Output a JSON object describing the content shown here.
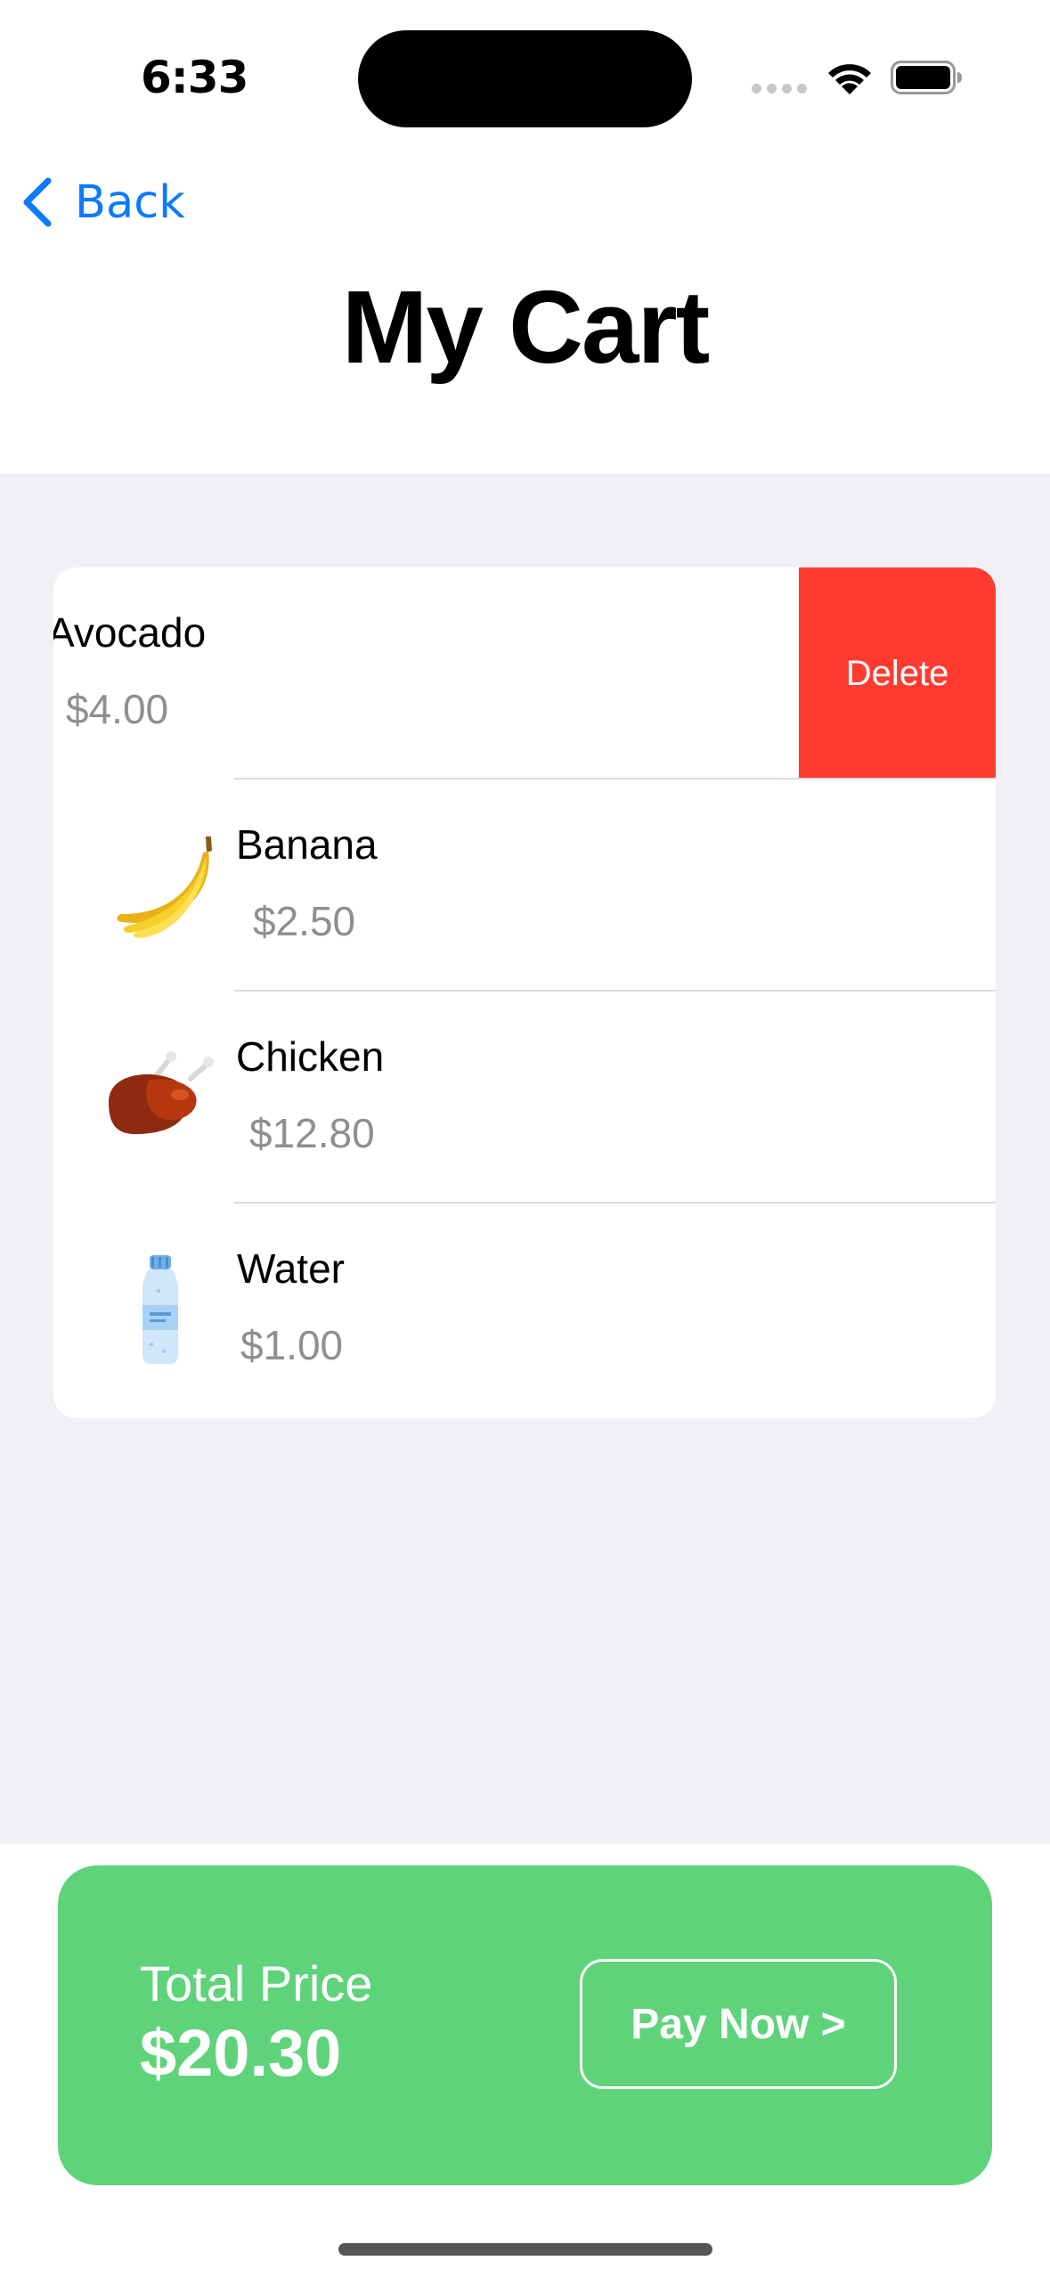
{
  "status_bar": {
    "time": "6:33"
  },
  "nav": {
    "back_label": "Back",
    "title": "My Cart"
  },
  "cart": {
    "items": [
      {
        "name": "Avocado",
        "price": "$4.00",
        "icon": "avocado-icon",
        "swiped": true
      },
      {
        "name": "Banana",
        "price": "$2.50",
        "icon": "banana-icon"
      },
      {
        "name": "Chicken",
        "price": "$12.80",
        "icon": "chicken-icon"
      },
      {
        "name": "Water",
        "price": "$1.00",
        "icon": "water-bottle-icon"
      }
    ],
    "delete_label": "Delete"
  },
  "checkout": {
    "total_label": "Total Price",
    "total_value": "$20.30",
    "pay_label": "Pay Now >"
  },
  "colors": {
    "accent_blue": "#0a7aff",
    "delete_red": "#ff3b30",
    "checkout_green": "#5fd37a",
    "background_gray": "#f1f0f5",
    "secondary_text": "#8e8e93"
  }
}
